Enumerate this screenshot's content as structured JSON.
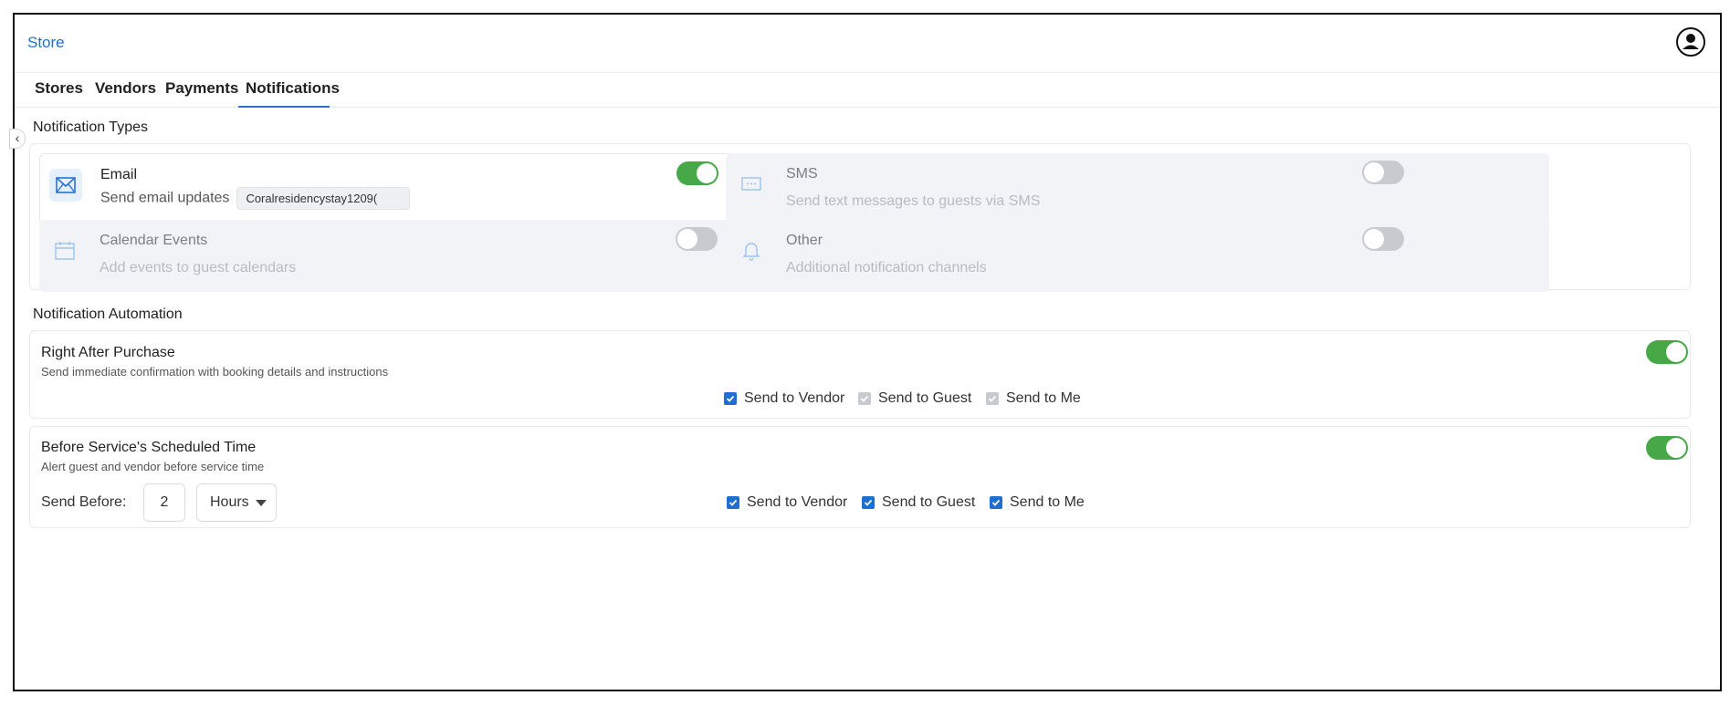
{
  "header": {
    "store_link": "Store",
    "account_icon": "user-circle-icon"
  },
  "tabs": [
    {
      "label": "Stores",
      "active": false
    },
    {
      "label": "Vendors",
      "active": false
    },
    {
      "label": "Payments",
      "active": false
    },
    {
      "label": "Notifications",
      "active": true
    }
  ],
  "notification_types": {
    "title": "Notification Types",
    "items": [
      {
        "title": "Email",
        "description": "Send email updates",
        "value": "Coralresidencystay1209(",
        "enabled": true,
        "icon": "envelope-icon"
      },
      {
        "title": "SMS",
        "description": "Send text messages to guests via SMS",
        "enabled": false,
        "icon": "message-icon"
      },
      {
        "title": "Calendar Events",
        "description": "Add events to guest calendars",
        "enabled": false,
        "icon": "calendar-icon"
      },
      {
        "title": "Other",
        "description": "Additional notification channels",
        "enabled": false,
        "icon": "bell-icon"
      }
    ]
  },
  "automation": {
    "title": "Notification Automation",
    "rules": [
      {
        "title": "Right After Purchase",
        "description": "Send immediate confirmation with booking details and instructions",
        "enabled": true,
        "recipients": [
          {
            "label": "Send to Vendor",
            "checked": true,
            "disabled": false
          },
          {
            "label": "Send to Guest",
            "checked": true,
            "disabled": true
          },
          {
            "label": "Send to Me",
            "checked": true,
            "disabled": true
          }
        ]
      },
      {
        "title": "Before Service's Scheduled Time",
        "description": "Alert guest and vendor before service time",
        "enabled": true,
        "send_before_label": "Send Before:",
        "send_before_value": "2",
        "send_before_unit": "Hours",
        "recipients": [
          {
            "label": "Send to Vendor",
            "checked": true,
            "disabled": false
          },
          {
            "label": "Send to Guest",
            "checked": true,
            "disabled": false
          },
          {
            "label": "Send to Me",
            "checked": true,
            "disabled": false
          }
        ]
      }
    ]
  },
  "colors": {
    "accent": "#1f6fd1",
    "toggle_on": "#46a846",
    "toggle_off": "#c7cbd0"
  }
}
